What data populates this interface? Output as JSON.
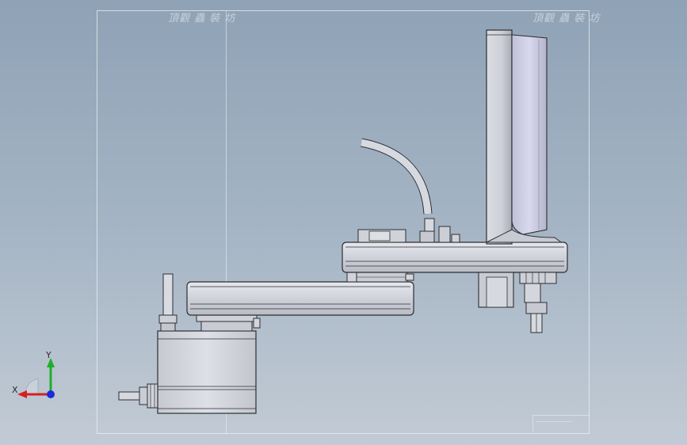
{
  "watermark": {
    "left_text": "頂觀 蟲 裝 坊",
    "right_text": "頂觀 蟲 裝 坊"
  },
  "triad": {
    "x_label": "X",
    "y_label": "Y",
    "x_color": "#d42020",
    "y_color": "#1fae2a",
    "z_color": "#1c2ad8"
  },
  "colors": {
    "background_top": "#8fa2b6",
    "background_bottom": "#c2cbd5",
    "part_fill": "#d4d7de",
    "part_edge": "#2e2e33"
  }
}
